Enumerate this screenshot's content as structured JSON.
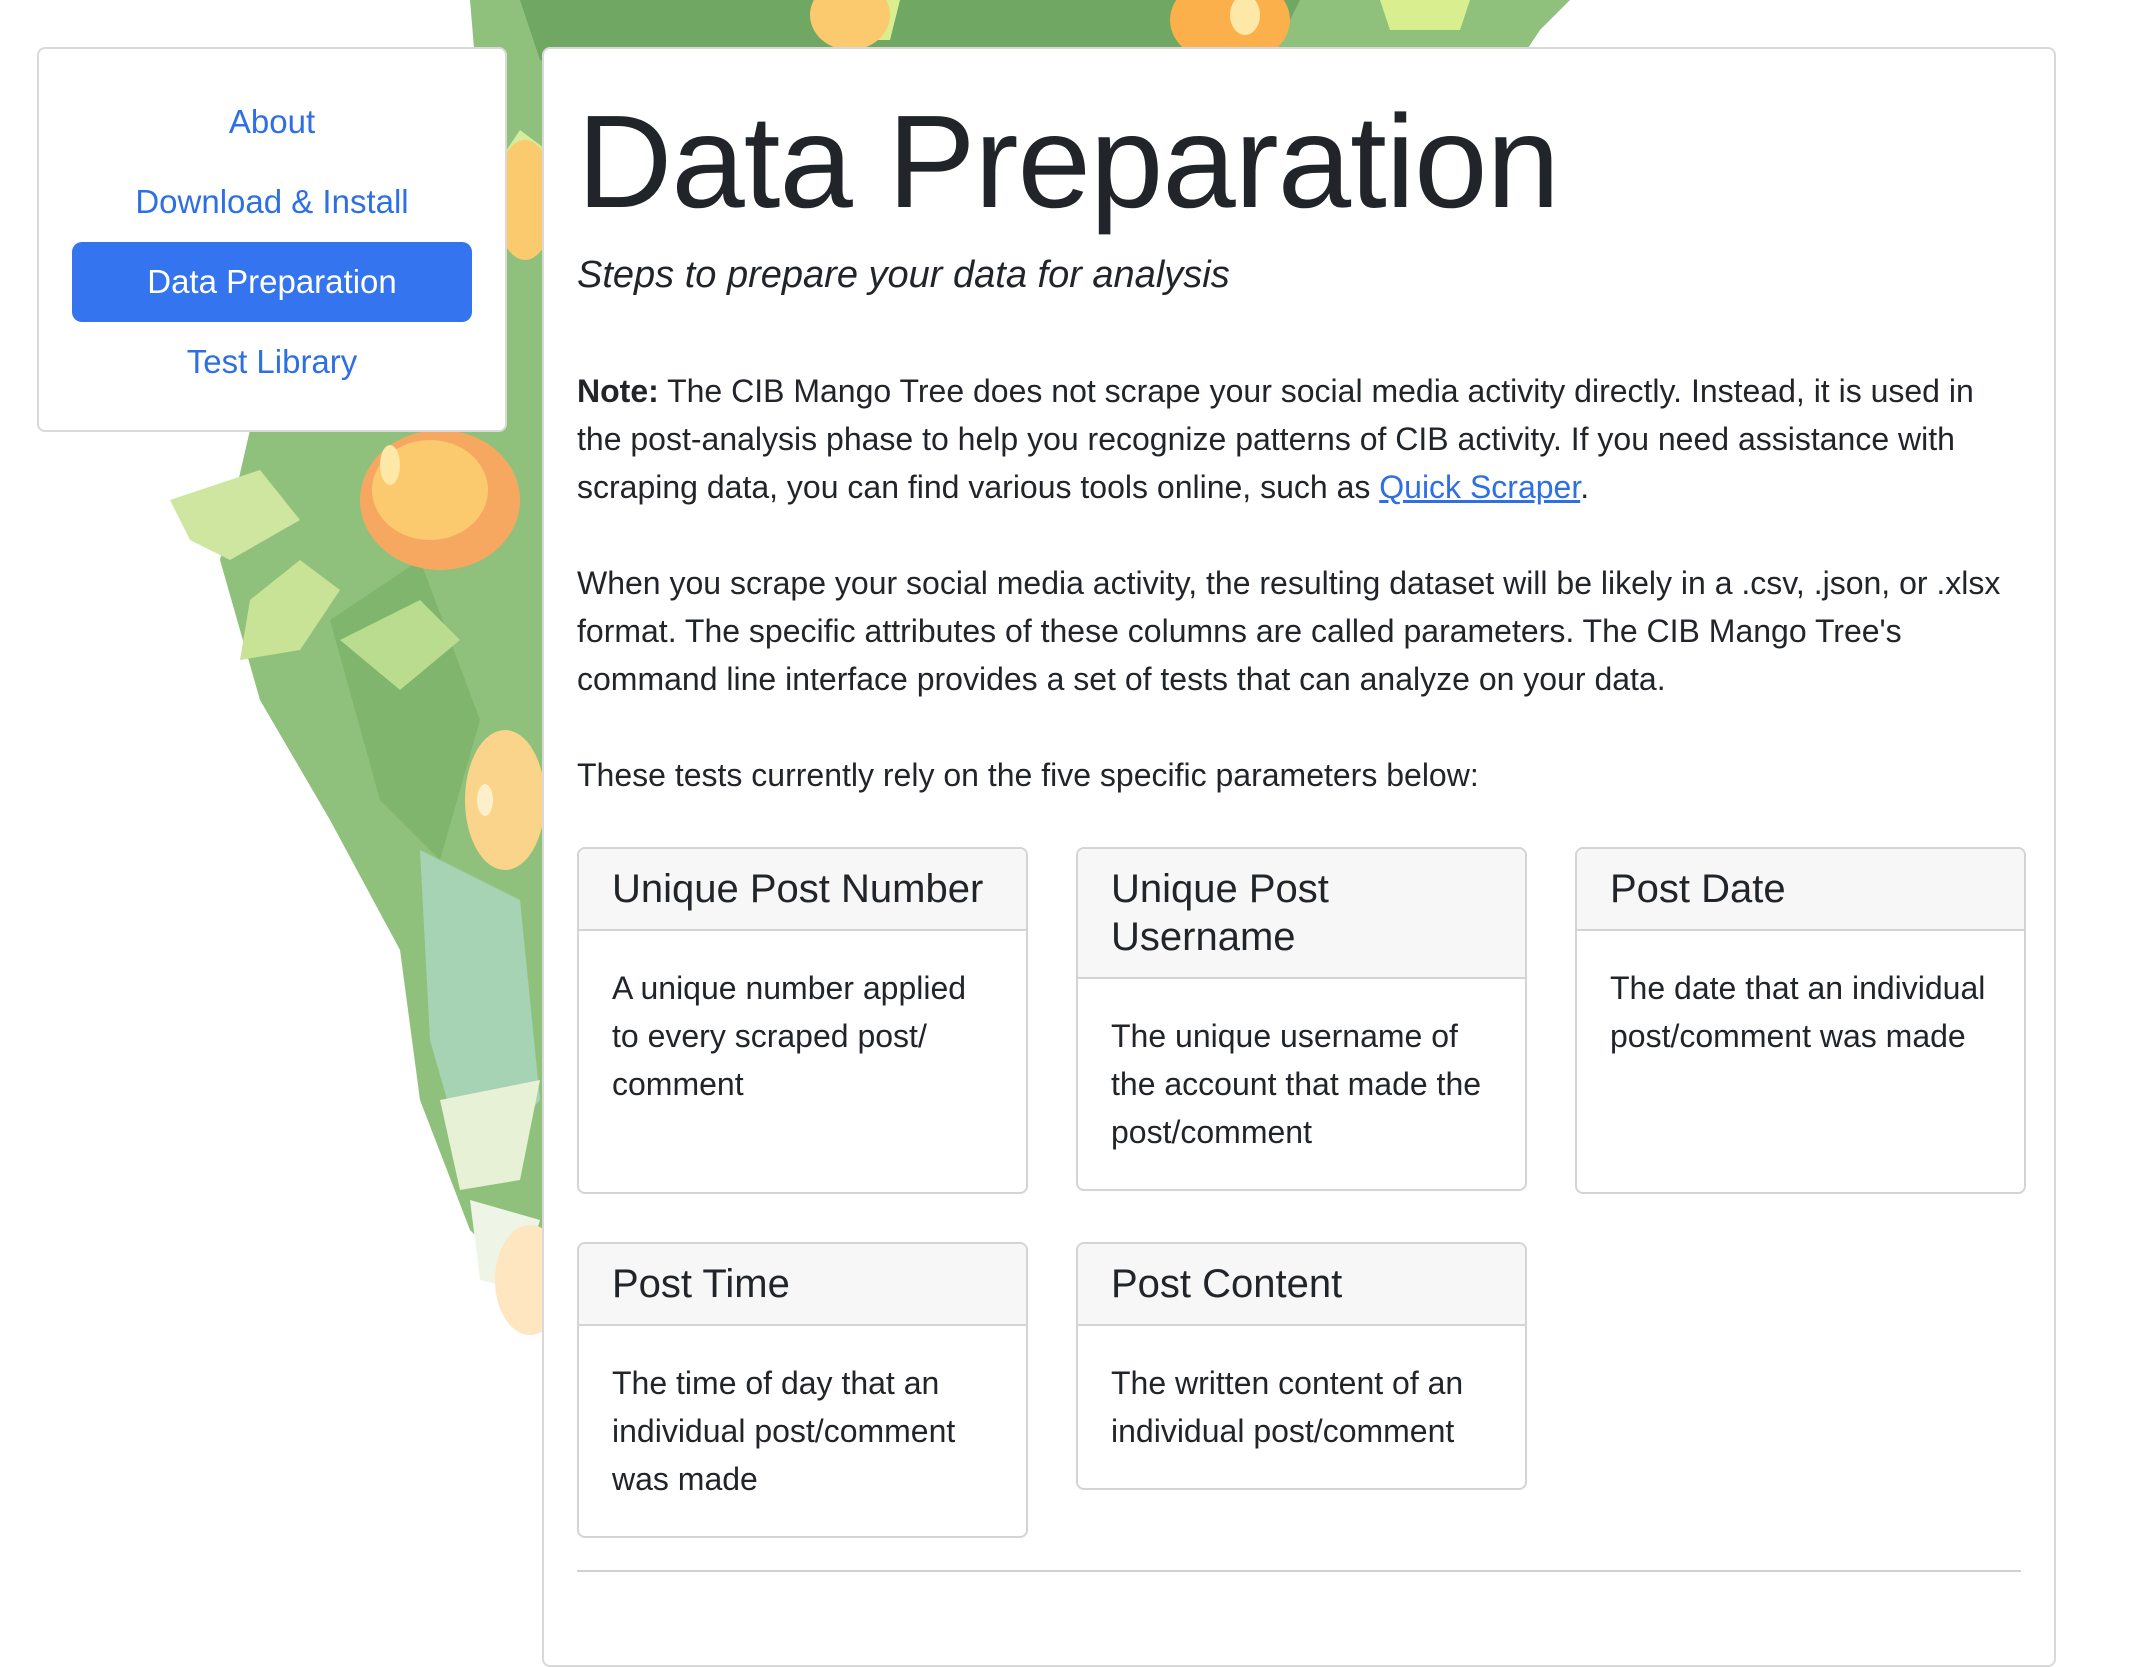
{
  "nav": {
    "items": [
      {
        "label": "About"
      },
      {
        "label": "Download & Install"
      },
      {
        "label": "Data Preparation"
      },
      {
        "label": "Test Library"
      }
    ]
  },
  "main": {
    "title": "Data Preparation",
    "subtitle": "Steps to prepare your data for analysis",
    "note_label": "Note:",
    "note_text": " The CIB Mango Tree does not scrape your social media activity directly. Instead, it is used in the post-analysis phase to help you recognize patterns of CIB activity. If you need assistance with scraping data, you can find various tools online, such as ",
    "note_link": "Quick Scraper",
    "note_end": ".",
    "paragraph2": "When you scrape your social media activity, the resulting dataset will be likely in a .csv, .json, or .xlsx format. The specific attributes of these columns are called parameters. The CIB Mango Tree's command line interface provides a set of tests that can analyze on your data.",
    "paragraph3": "These tests currently rely on the five specific parameters below:",
    "cards": [
      {
        "title": "Unique Post Number",
        "body": "A unique number applied to every scraped post/ comment"
      },
      {
        "title": "Unique Post Username",
        "body": "The unique username of the account that made the post/comment"
      },
      {
        "title": "Post Date",
        "body": "The date that an individual post/comment was made"
      },
      {
        "title": "Post Time",
        "body": "The time of day that an individual post/comment was made"
      },
      {
        "title": "Post Content",
        "body": "The written content of an individual post/comment"
      }
    ]
  },
  "colors": {
    "link": "#2f6fe6",
    "active_nav_bg": "#3474ee",
    "card_header_bg": "#f7f7f7",
    "border": "#d4d4d4"
  }
}
